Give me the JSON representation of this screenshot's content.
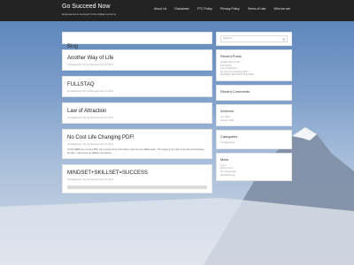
{
  "header": {
    "title": "Go Succeed Now",
    "description": "Empowered to succeed in the digital economy"
  },
  "nav": {
    "items": [
      "About Us",
      "Disclaimer",
      "FTC Policy",
      "Privacy Policy",
      "Terms of Use",
      "Who we are"
    ]
  },
  "main": {
    "heading": "Blog",
    "posts": [
      {
        "title": "Another Way of Life",
        "meta": "Uncategorized / By Go Succeed / Apr 18, 2014"
      },
      {
        "title": "FULLSTAQ",
        "meta": "Uncategorized / By Go Succeed / Apr 18, 2014"
      },
      {
        "title": "Law of Attraction",
        "meta": "Uncategorized / By Go Succeed / Apr 18, 2014"
      },
      {
        "title": "No Cost Life Changing PDF!",
        "meta": "Uncategorized / By Go Succeed / Apr 18, 2014",
        "excerpt": "CLICK HERE for your free PDF. Get to know some of the links in this post are affiliate links. This means if you click on the link and purchase the item, I will receive an affiliate commission."
      },
      {
        "title": "MINDSET+SKILLSET=SUCCESS",
        "meta": "Uncategorized / By Go Succeed / Apr 18, 2014"
      }
    ]
  },
  "sidebar": {
    "search_placeholder": "Search ...",
    "recent_posts": {
      "heading": "Recent Posts",
      "items": [
        "Another Way of Life",
        "FULLSTAQ",
        "Law of Attraction",
        "No Cost Life Changing PDF!",
        "MINDSET+SKILLSET=SUCCESS"
      ]
    },
    "recent_comments": {
      "heading": "Recent Comments"
    },
    "archives": {
      "heading": "Archives",
      "items": [
        "July 2014",
        "January 2014"
      ]
    },
    "categories": {
      "heading": "Categories",
      "items": [
        "Uncategorized"
      ]
    },
    "meta": {
      "heading": "Meta",
      "items": [
        "Log in",
        "Entries feed",
        "Comments feed",
        "WordPress.org"
      ]
    }
  }
}
